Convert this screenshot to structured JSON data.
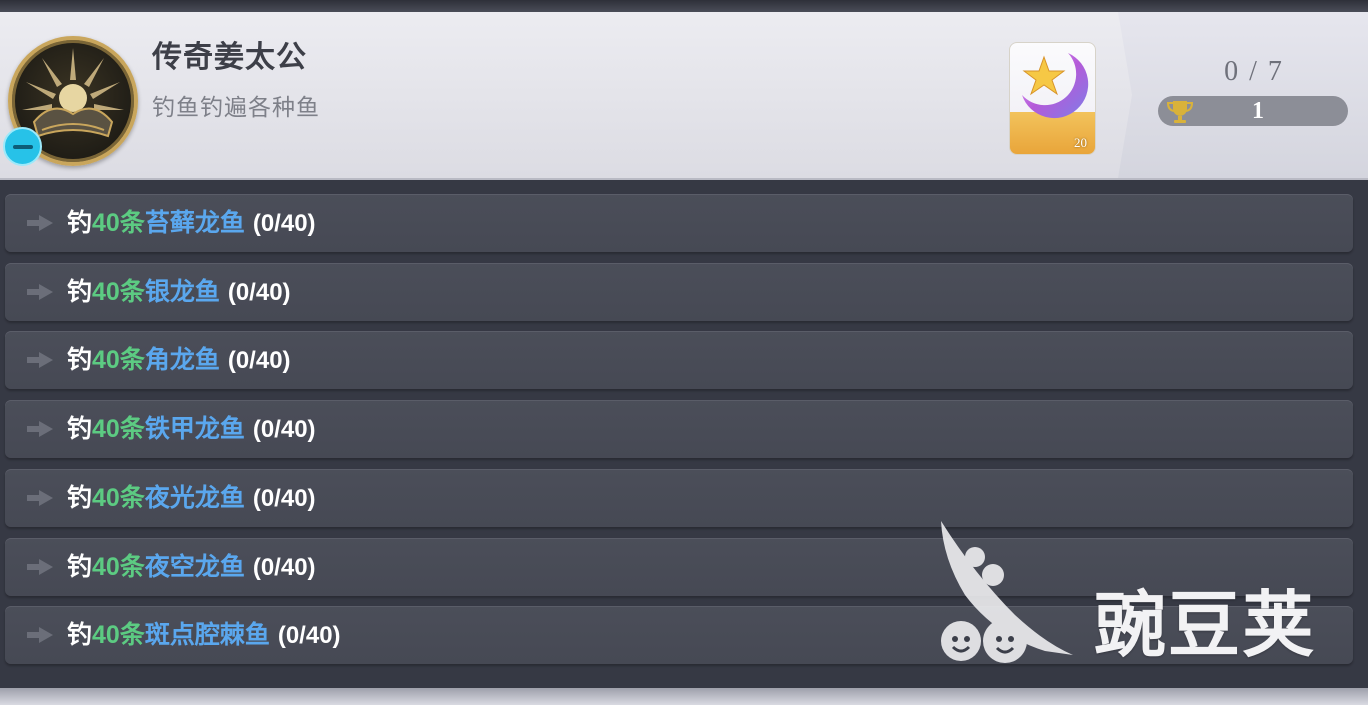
{
  "achievement": {
    "title": "传奇姜太公",
    "description": "钓鱼钓遍各种鱼",
    "progress": "0 / 7",
    "points": "1",
    "reward_quantity": "20",
    "emblem_icon": "fisherman-emblem-icon",
    "reward_icon": "starglitter-moon-icon"
  },
  "tasks": [
    {
      "verb": "钓",
      "count": "40条",
      "fish": "苔藓龙鱼",
      "progress": "(0/40)"
    },
    {
      "verb": "钓",
      "count": "40条",
      "fish": "银龙鱼",
      "progress": "(0/40)"
    },
    {
      "verb": "钓",
      "count": "40条",
      "fish": "角龙鱼",
      "progress": "(0/40)"
    },
    {
      "verb": "钓",
      "count": "40条",
      "fish": "铁甲龙鱼",
      "progress": "(0/40)"
    },
    {
      "verb": "钓",
      "count": "40条",
      "fish": "夜光龙鱼",
      "progress": "(0/40)"
    },
    {
      "verb": "钓",
      "count": "40条",
      "fish": "夜空龙鱼",
      "progress": "(0/40)"
    },
    {
      "verb": "钓",
      "count": "40条",
      "fish": "斑点腔棘鱼",
      "progress": "(0/40)"
    }
  ],
  "watermark": {
    "text": "豌豆荚"
  },
  "colors": {
    "count_green": "#5ccb82",
    "fish_blue": "#5aa7ee",
    "row_bg": "#4b4e59",
    "header_bg": "#e6e6ec",
    "badge_cyan": "#27c2e8"
  }
}
